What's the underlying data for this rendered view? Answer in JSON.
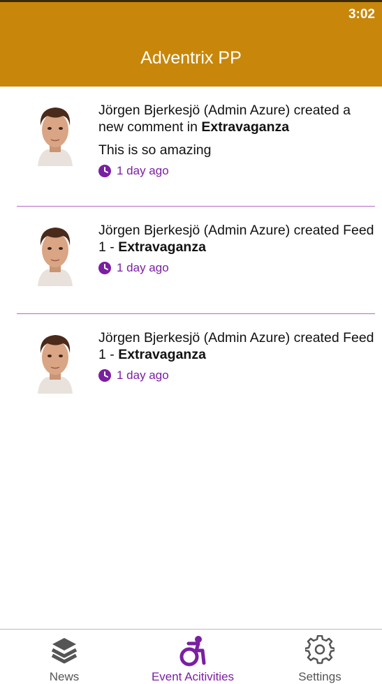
{
  "status_bar": {
    "time": "3:02"
  },
  "header": {
    "title": "Adventrix PP"
  },
  "feed": [
    {
      "author": "Jörgen Bjerkesjö (Admin Azure)",
      "action": "created a new comment in",
      "target": "Extravaganza",
      "comment": "This is so amazing",
      "time_ago": "1 day ago"
    },
    {
      "author": "Jörgen Bjerkesjö (Admin Azure)",
      "action": "created Feed 1 -",
      "target": "Extravaganza",
      "comment": "",
      "time_ago": "1 day ago"
    },
    {
      "author": "Jörgen Bjerkesjö (Admin Azure)",
      "action": "created Feed 1 -",
      "target": "Extravaganza",
      "comment": "",
      "time_ago": "1 day ago"
    }
  ],
  "bottom_nav": {
    "items": [
      {
        "label": "News",
        "icon": "layers-icon",
        "active": false
      },
      {
        "label": "Event Acitivities",
        "icon": "accessibility-icon",
        "active": true
      },
      {
        "label": "Settings",
        "icon": "gear-icon",
        "active": false
      }
    ]
  },
  "colors": {
    "header_bg": "#C8870A",
    "accent": "#7a1fa2",
    "divider": "#b768c8"
  }
}
